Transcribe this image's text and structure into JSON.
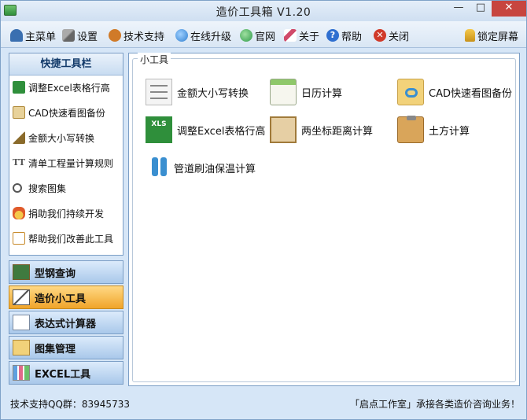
{
  "window": {
    "title": "造价工具箱 V1.20",
    "controls": {
      "minimize": "—",
      "maximize": "□",
      "close": "✕"
    }
  },
  "toolbar": {
    "items": [
      {
        "label": "主菜单",
        "icon": "people-icon",
        "color": "#3a6fb0"
      },
      {
        "label": "设置",
        "icon": "tools-icon",
        "color": "#8a8a8a"
      },
      {
        "label": "技术支持",
        "icon": "headset-icon",
        "color": "#d07a28"
      },
      {
        "label": "在线升级",
        "icon": "globe-icon",
        "color": "#2f7fd0"
      },
      {
        "label": "官网",
        "icon": "home-globe-icon",
        "color": "#2f9a4a"
      },
      {
        "label": "关于",
        "icon": "pencil-icon",
        "color": "#d04a6a"
      },
      {
        "label": "帮助",
        "icon": "help-icon",
        "color": "#2f6fd0"
      },
      {
        "label": "关闭",
        "icon": "close-icon",
        "color": "#d03a2a"
      }
    ],
    "lock_label": "锁定屏幕",
    "lock_icon": "lock-icon"
  },
  "quick": {
    "title": "快捷工具栏",
    "items": [
      {
        "label": "调整Excel表格行高",
        "icon": "excel-icon",
        "color": "#2f8f3b"
      },
      {
        "label": "CAD快速看图备份",
        "icon": "cad-book-icon",
        "color": "#b08a3a"
      },
      {
        "label": "金额大小写转换",
        "icon": "ruler-icon",
        "color": "#8a6a2a"
      },
      {
        "label": "清单工程量计算规则",
        "icon": "text-tt-icon",
        "color": "#555555"
      },
      {
        "label": "搜索图集",
        "icon": "magnifier-icon",
        "color": "#555555"
      },
      {
        "label": "捐助我们持续开发",
        "icon": "medal-icon",
        "color": "#e0a020"
      },
      {
        "label": "帮助我们改善此工具",
        "icon": "edit-note-icon",
        "color": "#c88a2a"
      }
    ]
  },
  "nav": [
    {
      "label": "型钢查询",
      "icon": "blackboard-icon",
      "active": false
    },
    {
      "label": "造价小工具",
      "icon": "drafting-icon",
      "active": true
    },
    {
      "label": "表达式计算器",
      "icon": "sheet-icon",
      "active": false
    },
    {
      "label": "图集管理",
      "icon": "folder-star-icon",
      "active": false
    },
    {
      "label": "EXCEL工具",
      "icon": "bars-icon",
      "active": false
    }
  ],
  "main": {
    "group_title": "小工具",
    "tools": [
      {
        "label": "金额大小写转换",
        "icon": "sliders-icon"
      },
      {
        "label": "日历计算",
        "icon": "calendar-icon"
      },
      {
        "label": "CAD快速看图备份",
        "icon": "folder-sync-icon"
      },
      {
        "label": "调整Excel表格行高",
        "icon": "xls-icon",
        "badge": "XLS"
      },
      {
        "label": "两坐标距离计算",
        "icon": "ruler-frame-icon"
      },
      {
        "label": "土方计算",
        "icon": "clipboard-icon"
      },
      {
        "label": "管道刷油保温计算",
        "icon": "pipes-icon"
      }
    ]
  },
  "status": {
    "left": "技术支持QQ群：83945733",
    "right": "「启点工作室」承接各类造价咨询业务！"
  }
}
